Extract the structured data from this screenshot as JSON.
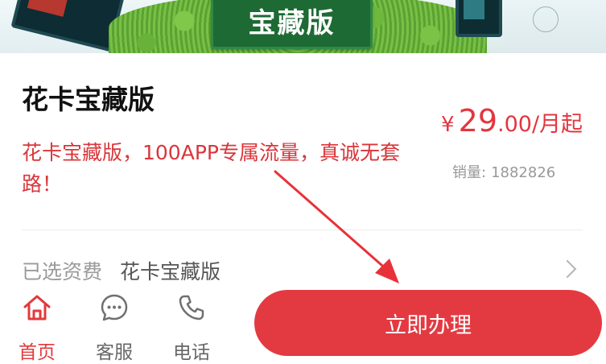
{
  "banner": {
    "plaque_text": "宝藏版"
  },
  "product": {
    "title": "花卡宝藏版",
    "description": "花卡宝藏版，100APP专属流量，真诚无套路！",
    "price": {
      "currency": "¥",
      "integer": "29",
      "decimal": ".00",
      "unit": "/月起"
    },
    "sales": {
      "label": "销量:",
      "count": "1882826"
    }
  },
  "plan": {
    "label": "已选资费",
    "value": "花卡宝藏版"
  },
  "tabbar": {
    "tabs": [
      {
        "label": "首页",
        "icon": "home-icon",
        "active": true
      },
      {
        "label": "客服",
        "icon": "chat-icon",
        "active": false
      },
      {
        "label": "电话",
        "icon": "phone-icon",
        "active": false
      }
    ],
    "apply_label": "立即办理"
  },
  "colors": {
    "accent": "#e33a42",
    "price": "#e3363f",
    "description": "#d9363b",
    "muted": "#999999"
  }
}
